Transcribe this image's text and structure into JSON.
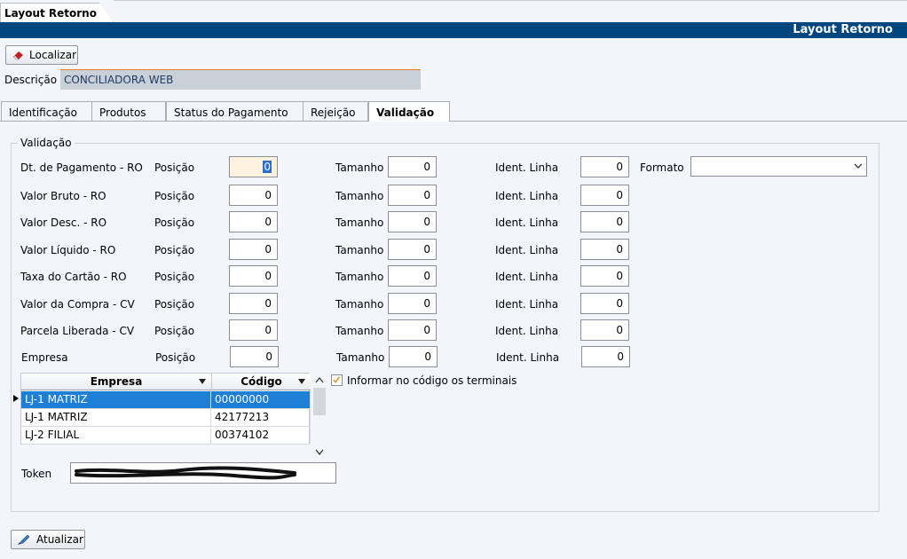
{
  "window": {
    "doc_tab": "Layout Retorno",
    "title": "Layout Retorno"
  },
  "toolbar": {
    "localizar": "Localizar"
  },
  "descricao": {
    "label": "Descrição",
    "value": "CONCILIADORA WEB"
  },
  "tabs": [
    {
      "label": "Identificação",
      "active": false
    },
    {
      "label": "Produtos",
      "active": false
    },
    {
      "label": "Status do Pagamento",
      "active": false
    },
    {
      "label": "Rejeição",
      "active": false
    },
    {
      "label": "Validação",
      "active": true
    }
  ],
  "validacao": {
    "group_title": "Validação",
    "col_posicao": "Posição",
    "col_tamanho": "Tamanho",
    "col_ident": "Ident. Linha",
    "formato_label": "Formato",
    "formato_value": "",
    "rows": [
      {
        "label": "Dt. de Pagamento - RO",
        "posicao": "0",
        "tamanho": "0",
        "ident": "0"
      },
      {
        "label": "Valor Bruto - RO",
        "posicao": "0",
        "tamanho": "0",
        "ident": "0"
      },
      {
        "label": "Valor Desc. - RO",
        "posicao": "0",
        "tamanho": "0",
        "ident": "0"
      },
      {
        "label": "Valor Líquido - RO",
        "posicao": "0",
        "tamanho": "0",
        "ident": "0"
      },
      {
        "label": "Taxa do Cartão - RO",
        "posicao": "0",
        "tamanho": "0",
        "ident": "0"
      },
      {
        "label": "Valor da Compra - CV",
        "posicao": "0",
        "tamanho": "0",
        "ident": "0"
      },
      {
        "label": "Parcela Liberada - CV",
        "posicao": "0",
        "tamanho": "0",
        "ident": "0"
      },
      {
        "label": "Empresa",
        "posicao": "0",
        "tamanho": "0",
        "ident": "0"
      }
    ]
  },
  "grid": {
    "headers": [
      "Empresa",
      "Código"
    ],
    "rows": [
      {
        "empresa": "LJ-1 MATRIZ",
        "codigo": "00000000",
        "selected": true
      },
      {
        "empresa": "LJ-1 MATRIZ",
        "codigo": "42177213",
        "selected": false
      },
      {
        "empresa": "LJ-2 FILIAL",
        "codigo": "00374102",
        "selected": false
      }
    ]
  },
  "checkbox": {
    "label": "Informar no código os terminais",
    "checked": true
  },
  "token": {
    "label": "Token"
  },
  "footer": {
    "atualizar": "Atualizar"
  },
  "colors": {
    "title_bar": "#00467e",
    "selection": "#1e7fd6",
    "focus_field": "#fff3df"
  }
}
